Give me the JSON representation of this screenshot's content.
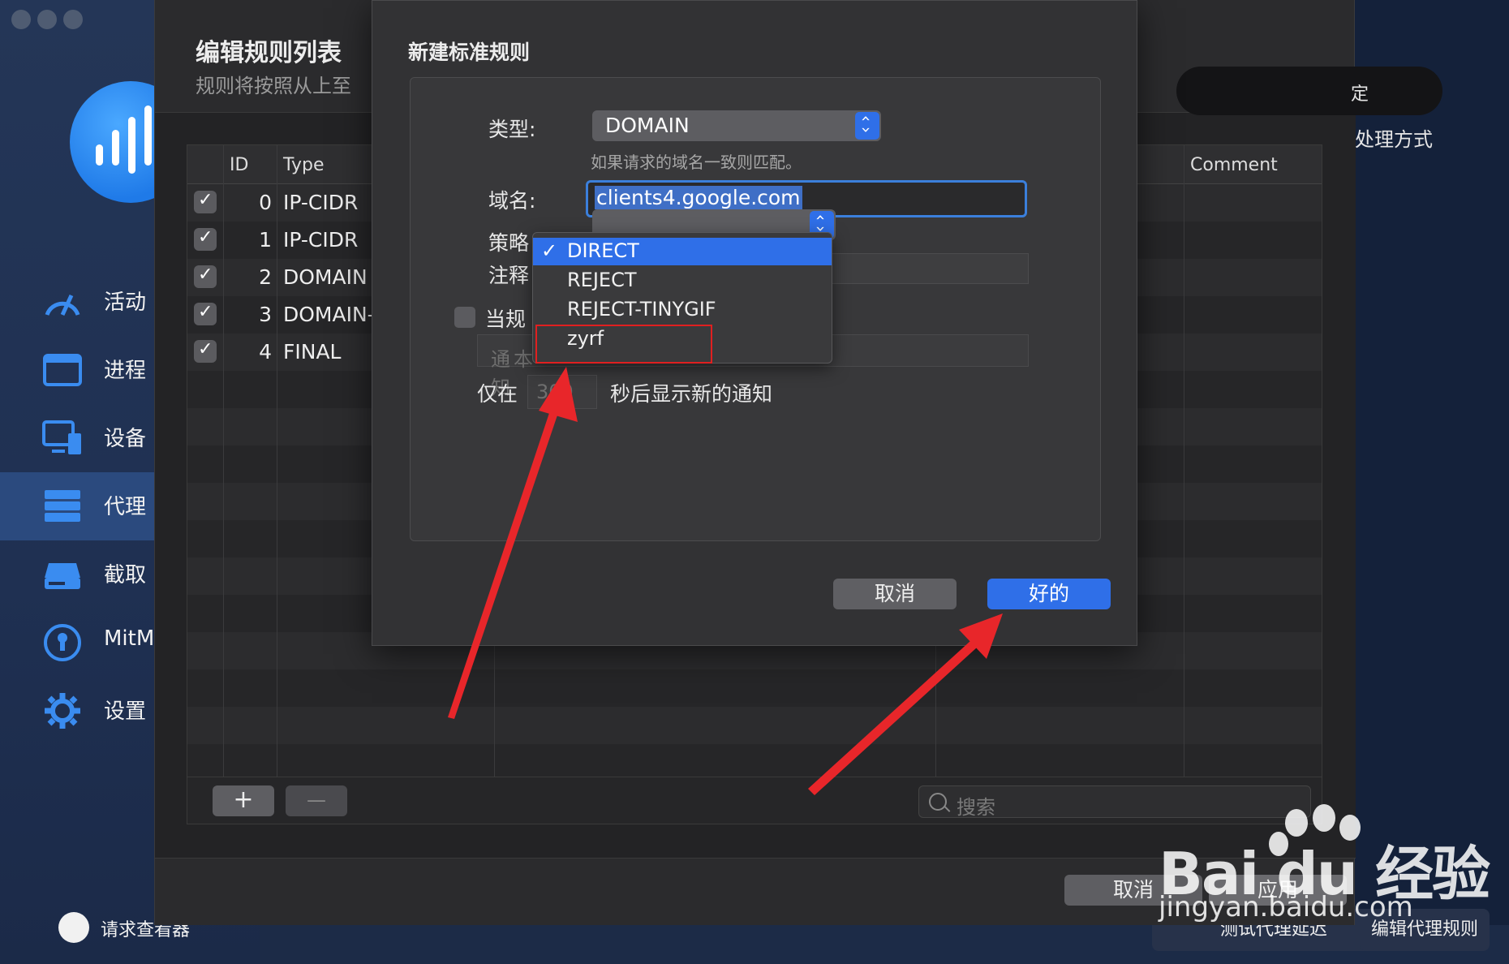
{
  "sidebar": {
    "items": [
      {
        "label": "活动",
        "icon": "speedometer-icon"
      },
      {
        "label": "进程",
        "icon": "window-icon"
      },
      {
        "label": "设备",
        "icon": "devices-icon"
      },
      {
        "label": "代理",
        "icon": "server-stack-icon",
        "active": true
      },
      {
        "label": "截取",
        "icon": "drive-icon"
      },
      {
        "label": "MitM",
        "icon": "keyhole-icon"
      },
      {
        "label": "设置",
        "icon": "gear-icon"
      }
    ],
    "inspector_label": "请求查看器"
  },
  "rules_sheet": {
    "title": "编辑规则列表",
    "subtitle": "规则将按照从上至",
    "confirm_partial": "定",
    "process_partial": "处理方式",
    "columns": {
      "id": "ID",
      "type": "Type",
      "comment": "Comment"
    },
    "rows": [
      {
        "id": "0",
        "type": "IP-CIDR",
        "enabled": true
      },
      {
        "id": "1",
        "type": "IP-CIDR",
        "enabled": true
      },
      {
        "id": "2",
        "type": "DOMAIN",
        "enabled": true
      },
      {
        "id": "3",
        "type": "DOMAIN-",
        "enabled": true
      },
      {
        "id": "4",
        "type": "FINAL",
        "enabled": true
      }
    ],
    "add_label": "+",
    "remove_label": "—",
    "search_placeholder": "搜索",
    "cancel_label": "取消",
    "apply_label": "应用"
  },
  "bottom_bar": {
    "test_latency_label": "测试代理延迟",
    "edit_rules_label": "编辑代理规则"
  },
  "dialog": {
    "title": "新建标准规则",
    "type_label": "类型:",
    "type_value": "DOMAIN",
    "type_hint": "如果请求的域名一致则匹配。",
    "domain_label": "域名:",
    "domain_value": "clients4.google.com",
    "policy_label": "策略",
    "comment_label": "注释",
    "notify_label_a": "当规",
    "notify_label_b": "通知",
    "notify_text_placeholder_a": "通知",
    "notify_text_placeholder_b": "本",
    "delay_prefix": "仅在",
    "delay_value": "300",
    "delay_suffix": "秒后显示新的通知",
    "cancel_label": "取消",
    "ok_label": "好的"
  },
  "policy_menu": {
    "check_mark": "✓",
    "options": [
      "DIRECT",
      "REJECT",
      "REJECT-TINYGIF",
      "zyrf"
    ],
    "selected": "DIRECT",
    "highlighted_box": "zyrf"
  },
  "watermark": {
    "brand": "Bai du 经验",
    "url": "jingyan.baidu.com"
  },
  "colors": {
    "accent": "#2f6fe8",
    "annotation_red": "#e02020",
    "sidebar_bg": "#243657"
  }
}
